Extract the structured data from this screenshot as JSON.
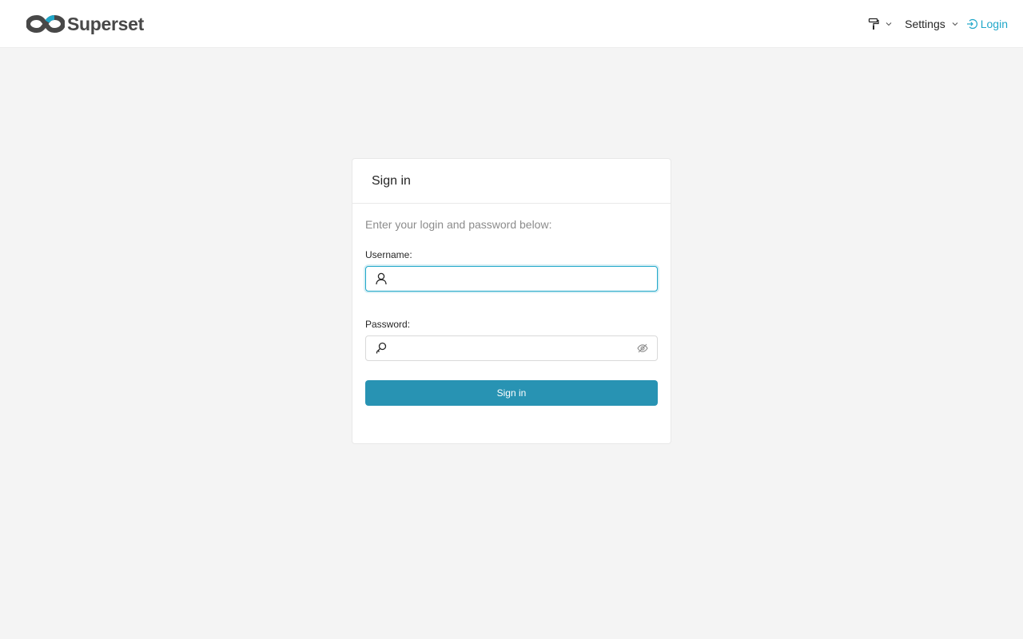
{
  "navbar": {
    "brand": "Superset",
    "settings_label": "Settings",
    "login_label": "Login",
    "icons": {
      "logo": "superset-infinity-logo",
      "theme": "paint-roller-icon",
      "dropdown": "chevron-down-icon",
      "login": "login-icon"
    }
  },
  "login_card": {
    "title": "Sign in",
    "hint": "Enter your login and password below:",
    "username": {
      "label": "Username:",
      "value": "",
      "placeholder": ""
    },
    "password": {
      "label": "Password:",
      "value": "",
      "placeholder": ""
    },
    "submit_label": "Sign in"
  },
  "colors": {
    "accent": "#20a7c9",
    "button": "#2893b3",
    "background": "#f4f4f4"
  }
}
